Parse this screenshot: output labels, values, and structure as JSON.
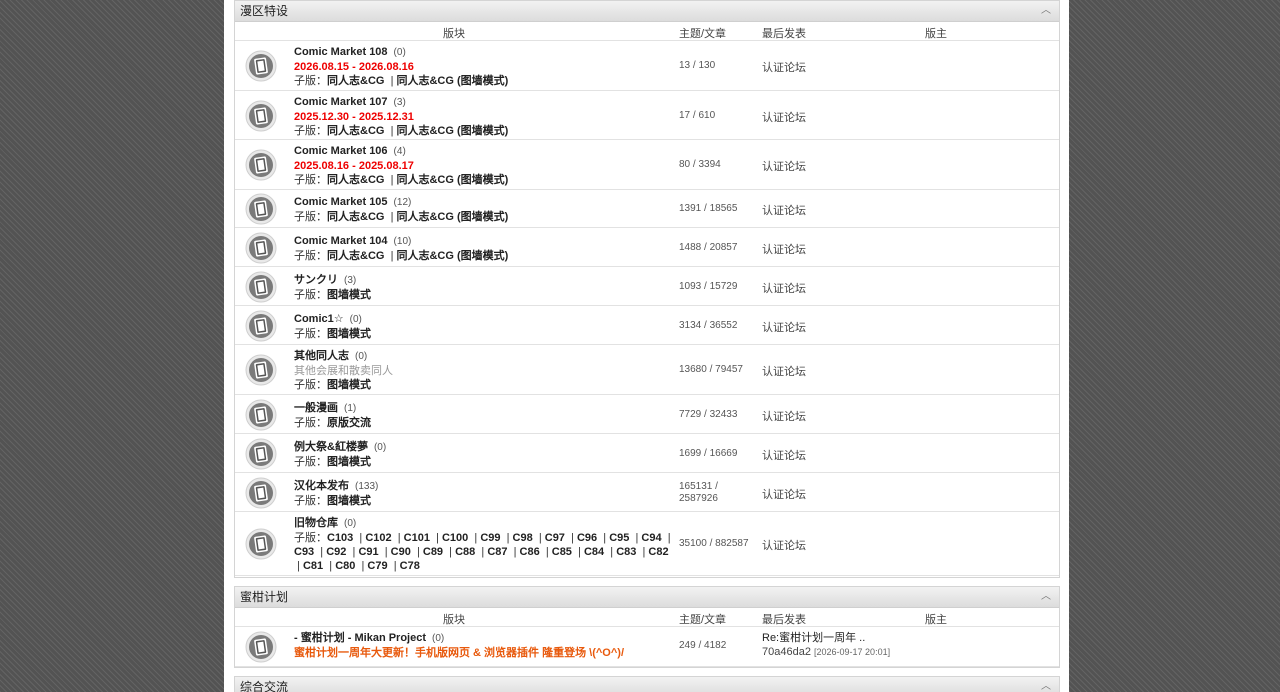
{
  "columns": {
    "forum": "版块",
    "stats": "主题/文章",
    "last": "最后发表",
    "mod": "版主"
  },
  "categories": [
    {
      "title": "漫区特设",
      "rows": [
        {
          "title": "Comic Market 108",
          "count": "(0)",
          "date": "2026.08.15 - 2026.08.16",
          "subs": "子版：<b>同人志&amp;CG</b> &nbsp;| <b>同人志&amp;CG (图墙模式)</b>",
          "stats": "13 / 130",
          "last": "认证论坛"
        },
        {
          "title": "Comic Market 107",
          "count": "(3)",
          "date": "2025.12.30 - 2025.12.31",
          "subs": "子版：<b>同人志&amp;CG</b> &nbsp;| <b>同人志&amp;CG (图墙模式)</b>",
          "stats": "17 / 610",
          "last": "认证论坛"
        },
        {
          "title": "Comic Market 106",
          "count": "(4)",
          "date": "2025.08.16 - 2025.08.17",
          "subs": "子版：<b>同人志&amp;CG</b> &nbsp;| <b>同人志&amp;CG (图墙模式)</b>",
          "stats": "80 / 3394",
          "last": "认证论坛"
        },
        {
          "title": "Comic Market 105",
          "count": "(12)",
          "subs": "子版：<b>同人志&amp;CG</b> &nbsp;| <b>同人志&amp;CG (图墙模式)</b>",
          "stats": "1391 / 18565",
          "last": "认证论坛"
        },
        {
          "title": "Comic Market 104",
          "count": "(10)",
          "subs": "子版：<b>同人志&amp;CG</b> &nbsp;| <b>同人志&amp;CG (图墙模式)</b>",
          "stats": "1488 / 20857",
          "last": "认证论坛"
        },
        {
          "title": "サンクリ",
          "count": "(3)",
          "subs": "子版：<b>图墙模式</b>",
          "stats": "1093 / 15729",
          "last": "认证论坛"
        },
        {
          "title": "Comic1☆",
          "count": "(0)",
          "subs": "子版：<b>图墙模式</b>",
          "stats": "3134 / 36552",
          "last": "认证论坛"
        },
        {
          "title": "其他同人志",
          "count": "(0)",
          "desc": "其他会展和散卖同人",
          "subs": "子版：<b>图墙模式</b>",
          "stats": "13680 / 79457",
          "last": "认证论坛"
        },
        {
          "title": "一般漫画",
          "count": "(1)",
          "subs": "子版：<b>原版交流</b>",
          "stats": "7729 / 32433",
          "last": "认证论坛"
        },
        {
          "title": "例大祭&紅楼夢",
          "count": "(0)",
          "subs": "子版：<b>图墙模式</b>",
          "stats": "1699 / 16669",
          "last": "认证论坛"
        },
        {
          "title": "汉化本发布",
          "count": "(133)",
          "subs": "子版：<b>图墙模式</b>",
          "stats": "165131 / 2587926",
          "last": "认证论坛"
        },
        {
          "title": "旧物仓库",
          "count": "(0)",
          "subs": "子版：<b>C103</b> &nbsp;| <b>C102</b> &nbsp;| <b>C101</b> &nbsp;| <b>C100</b> &nbsp;| <b>C99</b> &nbsp;| <b>C98</b> &nbsp;| <b>C97</b> &nbsp;| <b>C96</b> &nbsp;| <b>C95</b> &nbsp;| <b>C94</b> &nbsp;| <b>C93</b> &nbsp;| <b>C92</b> &nbsp;| <b>C91</b> &nbsp;| <b>C90</b> &nbsp;| <b>C89</b> &nbsp;| <b>C88</b> &nbsp;| <b>C87</b> &nbsp;| <b>C86</b> &nbsp;| <b>C85</b> &nbsp;| <b>C84</b> &nbsp;| <b>C83</b> &nbsp;| <b>C82</b> &nbsp;| <b>C81</b> &nbsp;| <b>C80</b> &nbsp;| <b>C79</b> &nbsp;| <b>C78</b>",
          "stats": "35100 / 882587",
          "last": "认证论坛"
        }
      ]
    },
    {
      "title": "蜜柑计划",
      "rows": [
        {
          "title": "- 蜜柑计划 - Mikan Project",
          "count": "(0)",
          "announce": "蜜柑计划一周年大更新！手机版网页 & 浏览器插件 隆重登场 \\(^O^)/",
          "stats": "249 / 4182",
          "last_title": "Re:蜜柑计划一周年 ..",
          "last_user": "70a46da2",
          "last_time": "[2026-09-17 20:01]"
        }
      ]
    },
    {
      "title": "综合交流"
    }
  ]
}
